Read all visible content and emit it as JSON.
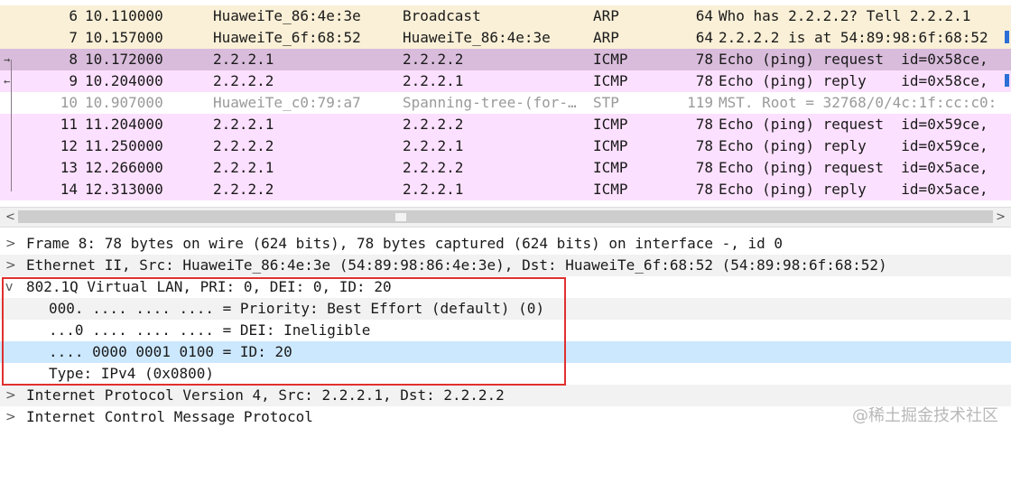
{
  "packets": [
    {
      "no": "6",
      "time": "10.110000",
      "src": "HuaweiTe_86:4e:3e",
      "dst": "Broadcast",
      "proto": "ARP",
      "len": "64",
      "info": "Who has 2.2.2.2? Tell 2.2.2.1"
    },
    {
      "no": "7",
      "time": "10.157000",
      "src": "HuaweiTe_6f:68:52",
      "dst": "HuaweiTe_86:4e:3e",
      "proto": "ARP",
      "len": "64",
      "info": "2.2.2.2 is at 54:89:98:6f:68:52"
    },
    {
      "no": "8",
      "time": "10.172000",
      "src": "2.2.2.1",
      "dst": "2.2.2.2",
      "proto": "ICMP",
      "len": "78",
      "info": "Echo (ping) request  id=0x58ce,"
    },
    {
      "no": "9",
      "time": "10.204000",
      "src": "2.2.2.2",
      "dst": "2.2.2.1",
      "proto": "ICMP",
      "len": "78",
      "info": "Echo (ping) reply    id=0x58ce,"
    },
    {
      "no": "10",
      "time": "10.907000",
      "src": "HuaweiTe_c0:79:a7",
      "dst": "Spanning-tree-(for-…",
      "proto": "STP",
      "len": "119",
      "info": "MST. Root = 32768/0/4c:1f:cc:c0:"
    },
    {
      "no": "11",
      "time": "11.204000",
      "src": "2.2.2.1",
      "dst": "2.2.2.2",
      "proto": "ICMP",
      "len": "78",
      "info": "Echo (ping) request  id=0x59ce,"
    },
    {
      "no": "12",
      "time": "11.250000",
      "src": "2.2.2.2",
      "dst": "2.2.2.1",
      "proto": "ICMP",
      "len": "78",
      "info": "Echo (ping) reply    id=0x59ce,"
    },
    {
      "no": "13",
      "time": "12.266000",
      "src": "2.2.2.1",
      "dst": "2.2.2.2",
      "proto": "ICMP",
      "len": "78",
      "info": "Echo (ping) request  id=0x5ace,"
    },
    {
      "no": "14",
      "time": "12.313000",
      "src": "2.2.2.2",
      "dst": "2.2.2.1",
      "proto": "ICMP",
      "len": "78",
      "info": "Echo (ping) reply    id=0x5ace,"
    }
  ],
  "scroll": {
    "left_arrow": "<",
    "right_arrow": ">"
  },
  "details": [
    {
      "twisty": ">",
      "text": "Frame 8: 78 bytes on wire (624 bits), 78 bytes captured (624 bits) on interface -, id 0"
    },
    {
      "twisty": ">",
      "text": "Ethernet II, Src: HuaweiTe_86:4e:3e (54:89:98:86:4e:3e), Dst: HuaweiTe_6f:68:52 (54:89:98:6f:68:52)"
    },
    {
      "twisty": "v",
      "text": "802.1Q Virtual LAN, PRI: 0, DEI: 0, ID: 20"
    },
    {
      "twisty": "",
      "text": "000. .... .... .... = Priority: Best Effort (default) (0)"
    },
    {
      "twisty": "",
      "text": "...0 .... .... .... = DEI: Ineligible"
    },
    {
      "twisty": "",
      "text": ".... 0000 0001 0100 = ID: 20"
    },
    {
      "twisty": "",
      "text": "Type: IPv4 (0x0800)"
    },
    {
      "twisty": ">",
      "text": "Internet Protocol Version 4, Src: 2.2.2.1, Dst: 2.2.2.2"
    },
    {
      "twisty": ">",
      "text": "Internet Control Message Protocol"
    }
  ],
  "watermark": "@稀土掘金技术社区",
  "colors": {
    "arp": "#faf0d7",
    "icmp": "#fce0ff",
    "selected": "#d9bcdb",
    "highlight": "#cce8ff",
    "annotation_box": "#e03030"
  }
}
